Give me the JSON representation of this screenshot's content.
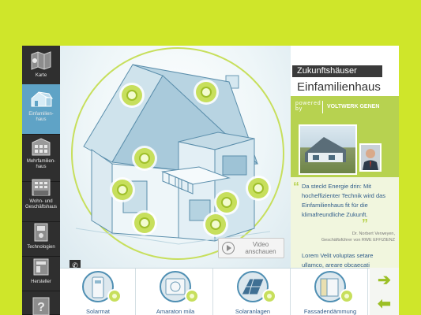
{
  "sidebar": {
    "items": [
      {
        "label": "Karte",
        "icon": "map-icon"
      },
      {
        "label": "Einfamilien-haus",
        "icon": "single-family-house-icon"
      },
      {
        "label": "Mehrfamilien-haus",
        "icon": "apartment-building-icon"
      },
      {
        "label": "Wohn- und Geschäftshaus",
        "icon": "commercial-building-icon"
      },
      {
        "label": "Technologien",
        "icon": "technology-icon"
      },
      {
        "label": "Hersteller",
        "icon": "manufacturer-icon"
      },
      {
        "label": "",
        "icon": "help-icon"
      }
    ]
  },
  "scene": {
    "video_label": "Video anschauen",
    "phone_glyph": "✆"
  },
  "panel": {
    "tab_label": "Zukunftshäuser",
    "heading": "Einfamilienhaus",
    "powered_label": "powered by",
    "brand": "VOLTWERK GENEN",
    "quote": "Da steckt Energie drin: Mit hocheffizienter Technik wird das Einfamilienhaus fit für die klimafreundliche Zukunft.",
    "quote_open": "“",
    "quote_close": "”",
    "author_name": "Dr. Norbert Verweyen,",
    "author_role": "Geschäftsführer von RWE EFFIZIENZ",
    "lorem": "Lorem Velit voluptas setare ullamco, areare obcaecati"
  },
  "products": [
    {
      "label": "Solarmat"
    },
    {
      "label": "Amaraton mila"
    },
    {
      "label": "Solaranlagen"
    },
    {
      "label": "Fassadendämmung"
    }
  ],
  "arrows": {
    "next": "➔",
    "prev": "⬅"
  },
  "colors": {
    "accent": "#c7df5c",
    "page_bg": "#cfe62a",
    "sidebar": "#2f2f2f",
    "active": "#5fa3c6",
    "text_blue": "#2f5c8a"
  }
}
